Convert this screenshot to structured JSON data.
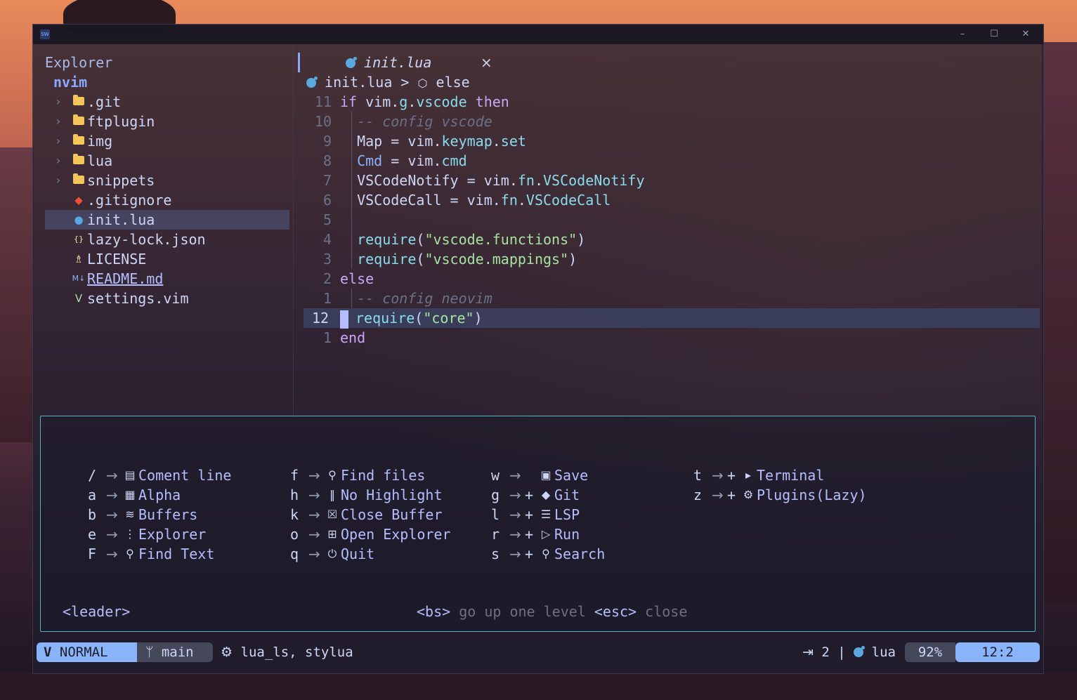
{
  "window": {
    "app_icon": "SW",
    "controls": {
      "minimize": "–",
      "maximize": "☐",
      "close": "✕"
    }
  },
  "explorer": {
    "title": "Explorer",
    "root": "nvim",
    "items": [
      {
        "name": ".git",
        "type": "folder",
        "icon": "folder-icon"
      },
      {
        "name": "ftplugin",
        "type": "folder",
        "icon": "folder-icon"
      },
      {
        "name": "img",
        "type": "folder",
        "icon": "folder-icon"
      },
      {
        "name": "lua",
        "type": "folder",
        "icon": "folder-icon"
      },
      {
        "name": "snippets",
        "type": "folder",
        "icon": "folder-icon"
      },
      {
        "name": ".gitignore",
        "type": "file",
        "icon": "git-icon",
        "color": "#f05133"
      },
      {
        "name": "init.lua",
        "type": "file",
        "icon": "lua-icon",
        "color": "#5aa8e0",
        "selected": true
      },
      {
        "name": "lazy-lock.json",
        "type": "file",
        "icon": "json-icon",
        "color": "#f9e2af"
      },
      {
        "name": "LICENSE",
        "type": "file",
        "icon": "license-icon",
        "color": "#f9e2af"
      },
      {
        "name": "README.md",
        "type": "file",
        "icon": "markdown-icon",
        "color": "#89b4fa",
        "link": true
      },
      {
        "name": "settings.vim",
        "type": "file",
        "icon": "vim-icon",
        "color": "#a6e3a1"
      }
    ]
  },
  "editor": {
    "tab": {
      "name": "init.lua",
      "close": "×"
    },
    "breadcrumb": {
      "file": "init.lua",
      "sep": ">",
      "symbol": "else"
    },
    "lines": [
      {
        "num": "11",
        "parts": [
          [
            "kw",
            "if "
          ],
          [
            "txt",
            "vim."
          ],
          [
            "fld",
            "g"
          ],
          [
            "txt",
            "."
          ],
          [
            "fld",
            "vscode"
          ],
          [
            "kw",
            " then"
          ]
        ]
      },
      {
        "num": "10",
        "guide": true,
        "parts": [
          [
            "cmt",
            "  -- config vscode"
          ]
        ]
      },
      {
        "num": "9",
        "guide": true,
        "parts": [
          [
            "txt",
            "  Map = vim."
          ],
          [
            "fld",
            "keymap"
          ],
          [
            "txt",
            "."
          ],
          [
            "fld",
            "set"
          ]
        ]
      },
      {
        "num": "8",
        "guide": true,
        "parts": [
          [
            "txt",
            "  "
          ],
          [
            "fn",
            "Cmd"
          ],
          [
            "txt",
            " = vim."
          ],
          [
            "fld",
            "cmd"
          ]
        ]
      },
      {
        "num": "7",
        "guide": true,
        "parts": [
          [
            "txt",
            "  VSCodeNotify = vim."
          ],
          [
            "fld",
            "fn"
          ],
          [
            "txt",
            "."
          ],
          [
            "fld",
            "VSCodeNotify"
          ]
        ]
      },
      {
        "num": "6",
        "guide": true,
        "parts": [
          [
            "txt",
            "  VSCodeCall = vim."
          ],
          [
            "fld",
            "fn"
          ],
          [
            "txt",
            "."
          ],
          [
            "fld",
            "VSCodeCall"
          ]
        ]
      },
      {
        "num": "5",
        "guide": true,
        "parts": []
      },
      {
        "num": "4",
        "guide": true,
        "parts": [
          [
            "txt",
            "  "
          ],
          [
            "fld",
            "require"
          ],
          [
            "txt",
            "("
          ],
          [
            "str",
            "\"vscode.functions\""
          ],
          [
            "txt",
            ")"
          ]
        ]
      },
      {
        "num": "3",
        "guide": true,
        "parts": [
          [
            "txt",
            "  "
          ],
          [
            "fld",
            "require"
          ],
          [
            "txt",
            "("
          ],
          [
            "str",
            "\"vscode.mappings\""
          ],
          [
            "txt",
            ")"
          ]
        ]
      },
      {
        "num": "2",
        "parts": [
          [
            "kw",
            "else"
          ]
        ]
      },
      {
        "num": "1",
        "guide": true,
        "parts": [
          [
            "cmt",
            "  -- config neovim"
          ]
        ]
      },
      {
        "num": "12",
        "current": true,
        "cursor": true,
        "parts": [
          [
            "fld",
            "require"
          ],
          [
            "txt",
            "("
          ],
          [
            "str",
            "\"core\""
          ],
          [
            "txt",
            ")"
          ]
        ]
      },
      {
        "num": "1",
        "parts": [
          [
            "kw",
            "end"
          ]
        ]
      }
    ]
  },
  "whichkey": {
    "columns": [
      [
        {
          "key": "/",
          "arrow": "→",
          "plus": "",
          "icon": "comment-icon",
          "glyph": "▤",
          "label": "Coment line"
        },
        {
          "key": "a",
          "arrow": "→",
          "plus": "",
          "icon": "dashboard-icon",
          "glyph": "▦",
          "label": "Alpha"
        },
        {
          "key": "b",
          "arrow": "→",
          "plus": "",
          "icon": "layers-icon",
          "glyph": "≋",
          "label": "Buffers"
        },
        {
          "key": "e",
          "arrow": "→",
          "plus": "",
          "icon": "tree-icon",
          "glyph": "⋮",
          "label": "Explorer"
        },
        {
          "key": "F",
          "arrow": "→",
          "plus": "",
          "icon": "search-icon",
          "glyph": "⚲",
          "label": "Find Text"
        }
      ],
      [
        {
          "key": "f",
          "arrow": "→",
          "plus": "",
          "icon": "search-icon",
          "glyph": "⚲",
          "label": "Find files"
        },
        {
          "key": "h",
          "arrow": "→",
          "plus": "",
          "icon": "no-highlight-icon",
          "glyph": "‖",
          "label": "No Highlight"
        },
        {
          "key": "k",
          "arrow": "→",
          "plus": "",
          "icon": "close-box-icon",
          "glyph": "☒",
          "label": "Close Buffer"
        },
        {
          "key": "o",
          "arrow": "→",
          "plus": "",
          "icon": "open-explorer-icon",
          "glyph": "⊞",
          "label": "Open Explorer"
        },
        {
          "key": "q",
          "arrow": "→",
          "plus": "",
          "icon": "quit-icon",
          "glyph": "⏻",
          "label": "Quit"
        }
      ],
      [
        {
          "key": "w",
          "arrow": "→",
          "plus": "",
          "icon": "save-icon",
          "glyph": "▣",
          "label": "Save"
        },
        {
          "key": "g",
          "arrow": "→",
          "plus": "+",
          "icon": "git-icon",
          "glyph": "◆",
          "label": "Git"
        },
        {
          "key": "l",
          "arrow": "→",
          "plus": "+",
          "icon": "sliders-icon",
          "glyph": "☰",
          "label": "LSP"
        },
        {
          "key": "r",
          "arrow": "→",
          "plus": "+",
          "icon": "run-icon",
          "glyph": "▷",
          "label": "Run"
        },
        {
          "key": "s",
          "arrow": "→",
          "plus": "+",
          "icon": "search-zoom-icon",
          "glyph": "⚲",
          "label": "Search"
        }
      ],
      [
        {
          "key": "t",
          "arrow": "→",
          "plus": "+",
          "icon": "terminal-icon",
          "glyph": "▸",
          "label": "Terminal"
        },
        {
          "key": "z",
          "arrow": "→",
          "plus": "+",
          "icon": "plugins-icon",
          "glyph": "⚙",
          "label": "Plugins(Lazy)"
        }
      ]
    ],
    "leader": "<leader>",
    "hint": {
      "bs_key": "<bs>",
      "bs_desc": "go up one level",
      "esc_key": "<esc>",
      "esc_desc": "close"
    }
  },
  "statusline": {
    "mode": "NORMAL",
    "branch": "main",
    "lsp": "lua_ls, stylua",
    "indent": "2",
    "filetype": "lua",
    "percent": "92%",
    "position": "12:2"
  },
  "colors": {
    "accent": "#89b4fa",
    "border": "#4fb3c6"
  }
}
